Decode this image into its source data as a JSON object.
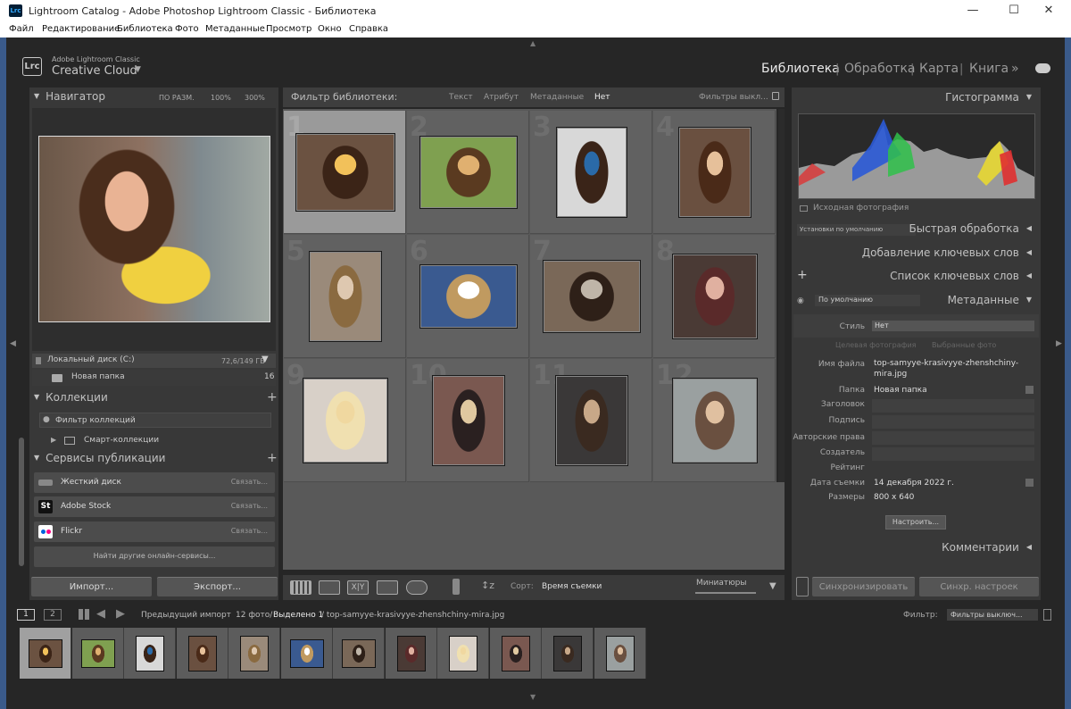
{
  "window": {
    "title": "Lightroom Catalog - Adobe Photoshop Lightroom Classic - Библиотека",
    "min": "—",
    "max": "☐",
    "close": "✕",
    "app_icon": "Lrc"
  },
  "menu": [
    "Файл",
    "Редактирование",
    "Библиотека",
    "Фото",
    "Метаданные",
    "Просмотр",
    "Окно",
    "Справка"
  ],
  "identity": {
    "logo": "Lrc",
    "line1": "Adobe Lightroom Classic",
    "line2": "Creative Cloud"
  },
  "modules": [
    "Библиотека",
    "Обработка",
    "Карта",
    "Книга"
  ],
  "modules_more": "»",
  "left": {
    "navigator": {
      "title": "Навигатор",
      "zoom": [
        "ПО РАЗМ.",
        "100%",
        "300%"
      ]
    },
    "disk": {
      "label": "Локальный диск (C:)",
      "size": "72,6/149 ГБ"
    },
    "folder": {
      "label": "Новая папка",
      "count": "16"
    },
    "collections": {
      "title": "Коллекции",
      "filter": "Фильтр коллекций",
      "smart": "Смарт-коллекции"
    },
    "publish": {
      "title": "Сервисы публикации",
      "services": [
        {
          "name": "Жесткий диск",
          "link": "Связать..."
        },
        {
          "name": "Adobe Stock",
          "link": "Связать...",
          "icon": "St"
        },
        {
          "name": "Flickr",
          "link": "Связать..."
        }
      ],
      "find": "Найти другие онлайн-сервисы..."
    },
    "import": "Импорт...",
    "export": "Экспорт..."
  },
  "filter": {
    "label": "Фильтр библиотеки:",
    "opts": [
      "Текст",
      "Атрибут",
      "Метаданные",
      "Нет"
    ],
    "preset": "Фильтры выкл..."
  },
  "grid": {
    "cells": [
      "1",
      "2",
      "3",
      "4",
      "5",
      "6",
      "7",
      "8",
      "9",
      "10",
      "11",
      "12"
    ]
  },
  "toolbar": {
    "sort_label": "Сорт:",
    "sort_value": "Время съемки",
    "thumbs": "Миниатюры"
  },
  "right": {
    "histogram": "Гистограмма",
    "original": "Исходная фотография",
    "quick": "Быстрая обработка",
    "quick_preset": "Установки по умолчанию",
    "add_kw": "Добавление ключевых слов",
    "kw_list": "Список ключевых слов",
    "metadata": "Метаданные",
    "meta_preset": "По умолчанию",
    "style_label": "Стиль",
    "style_value": "Нет",
    "target": "Целевая фотография",
    "selected": "Выбранные фото",
    "fields": {
      "filename_l": "Имя файла",
      "filename_v1": "top-samyye-krasivyye-zhenshchiny-",
      "filename_v2": "mira.jpg",
      "folder_l": "Папка",
      "folder_v": "Новая папка",
      "heading_l": "Заголовок",
      "caption_l": "Подпись",
      "copyright_l": "Авторские права",
      "creator_l": "Создатель",
      "rating_l": "Рейтинг",
      "date_l": "Дата съемки",
      "date_v": "14 декабря 2022 г.",
      "size_l": "Размеры",
      "size_v": "800 x 640"
    },
    "customize": "Настроить...",
    "comments": "Комментарии",
    "sync": "Синхронизировать",
    "sync_settings": "Синхр. настроек"
  },
  "status": {
    "view1": "1",
    "view2": "2",
    "source": "Предыдущий импорт",
    "count": "12 фото/",
    "selected": "Выделено 1",
    "file": "/ top-samyye-krasivyye-zhenshchiny-mira.jpg",
    "filter_label": "Фильтр:",
    "filter_value": "Фильтры выключ..."
  },
  "filmstrip": {
    "count": 12
  }
}
